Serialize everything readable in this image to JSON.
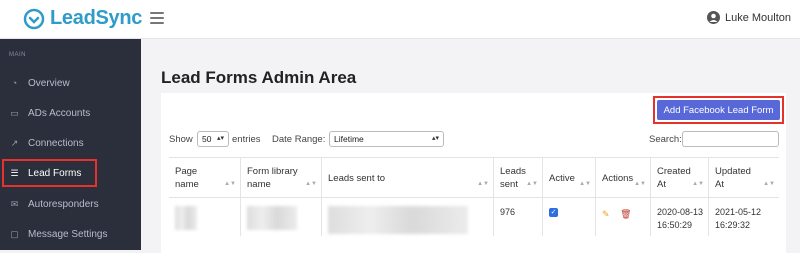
{
  "app": {
    "brand": "LeadSync",
    "brand_color": "#2f9bc9",
    "user_name": "Luke Moulton"
  },
  "sidebar": {
    "section_label": "MAIN",
    "items": [
      {
        "label": "Overview",
        "icon": "gauge-icon"
      },
      {
        "label": "ADs Accounts",
        "icon": "folder-icon"
      },
      {
        "label": "Connections",
        "icon": "connection-icon"
      },
      {
        "label": "Lead Forms",
        "icon": "list-icon",
        "active": true
      },
      {
        "label": "Autoresponders",
        "icon": "envelope-icon"
      },
      {
        "label": "Message Settings",
        "icon": "chat-icon"
      }
    ]
  },
  "main": {
    "title": "Lead Forms Admin Area",
    "add_button": "Add Facebook Lead Form",
    "show_label": "Show",
    "show_value": "50",
    "entries_label": "entries",
    "date_range_label": "Date Range:",
    "date_range_value": "Lifetime",
    "search_label": "Search:",
    "search_value": ""
  },
  "table": {
    "columns": [
      "Page name",
      "Form library name",
      "Leads sent to",
      "Leads sent",
      "Active",
      "Actions",
      "Created At",
      "Updated At"
    ],
    "rows": [
      {
        "leads_sent": "976",
        "active": true,
        "created_at": "2020-08-13 16:50:29",
        "updated_at": "2021-05-12 16:29:32"
      }
    ]
  },
  "colors": {
    "primary_button": "#5868d8",
    "highlight": "#e5322d",
    "sidebar_bg": "#2b2e3b",
    "edit_icon": "#f0a020",
    "delete_icon": "#c0392b"
  }
}
